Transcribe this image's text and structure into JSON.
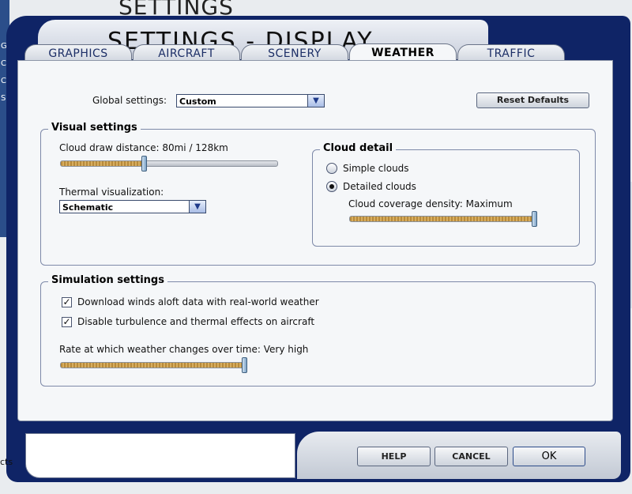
{
  "background": {
    "title": "SETTINGS",
    "left_letters": "G\nC\nC\nS",
    "bottom_text": "cts"
  },
  "window": {
    "title": "SETTINGS - DISPLAY"
  },
  "tabs": [
    {
      "label": "GRAPHICS"
    },
    {
      "label": "AIRCRAFT"
    },
    {
      "label": "SCENERY"
    },
    {
      "label": "WEATHER",
      "active": true
    },
    {
      "label": "TRAFFIC"
    }
  ],
  "global": {
    "label": "Global settings:",
    "value": "Custom"
  },
  "reset_label": "Reset Defaults",
  "visual": {
    "legend": "Visual settings",
    "cloud_draw_label": "Cloud draw distance: 80mi / 128km",
    "cloud_draw_level": 0.4,
    "thermal_label": "Thermal visualization:",
    "thermal_value": "Schematic"
  },
  "cloud_detail": {
    "legend": "Cloud detail",
    "simple_label": "Simple clouds",
    "detailed_label": "Detailed clouds",
    "selected": "detailed",
    "density_label": "Cloud coverage density: Maximum",
    "density_level": 1.0
  },
  "simulation": {
    "legend": "Simulation settings",
    "winds_label": "Download winds aloft data with real-world weather",
    "winds_checked": true,
    "turbulence_label": "Disable turbulence and thermal effects on aircraft",
    "turbulence_checked": true,
    "rate_label": "Rate at which weather changes over time: Very high",
    "rate_level": 1.0
  },
  "buttons": {
    "help": "HELP",
    "cancel": "CANCEL",
    "ok": "OK"
  }
}
